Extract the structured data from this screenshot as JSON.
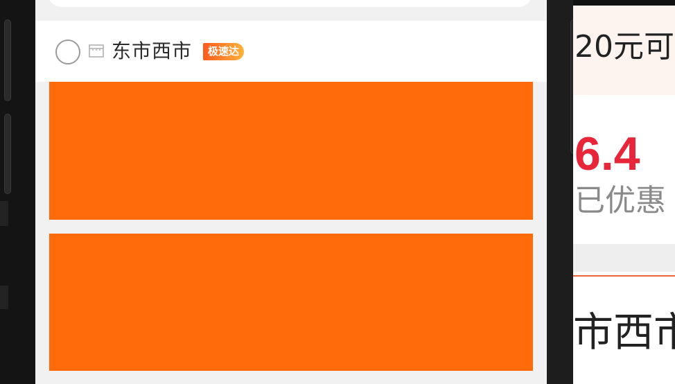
{
  "store": {
    "name": "东市西市",
    "badge": "极速达"
  },
  "right_panel": {
    "notice_text": "20元可",
    "price": "6.4",
    "discount_text": "已优惠",
    "store_name_partial": "市西市"
  },
  "icons": {
    "checkbox": "radio-circle-icon",
    "shop": "shop-icon"
  },
  "colors": {
    "banner": "#ff6a0a",
    "badge_start": "#ff5a1f",
    "badge_end": "#ffb33a",
    "price": "#e8263a"
  }
}
